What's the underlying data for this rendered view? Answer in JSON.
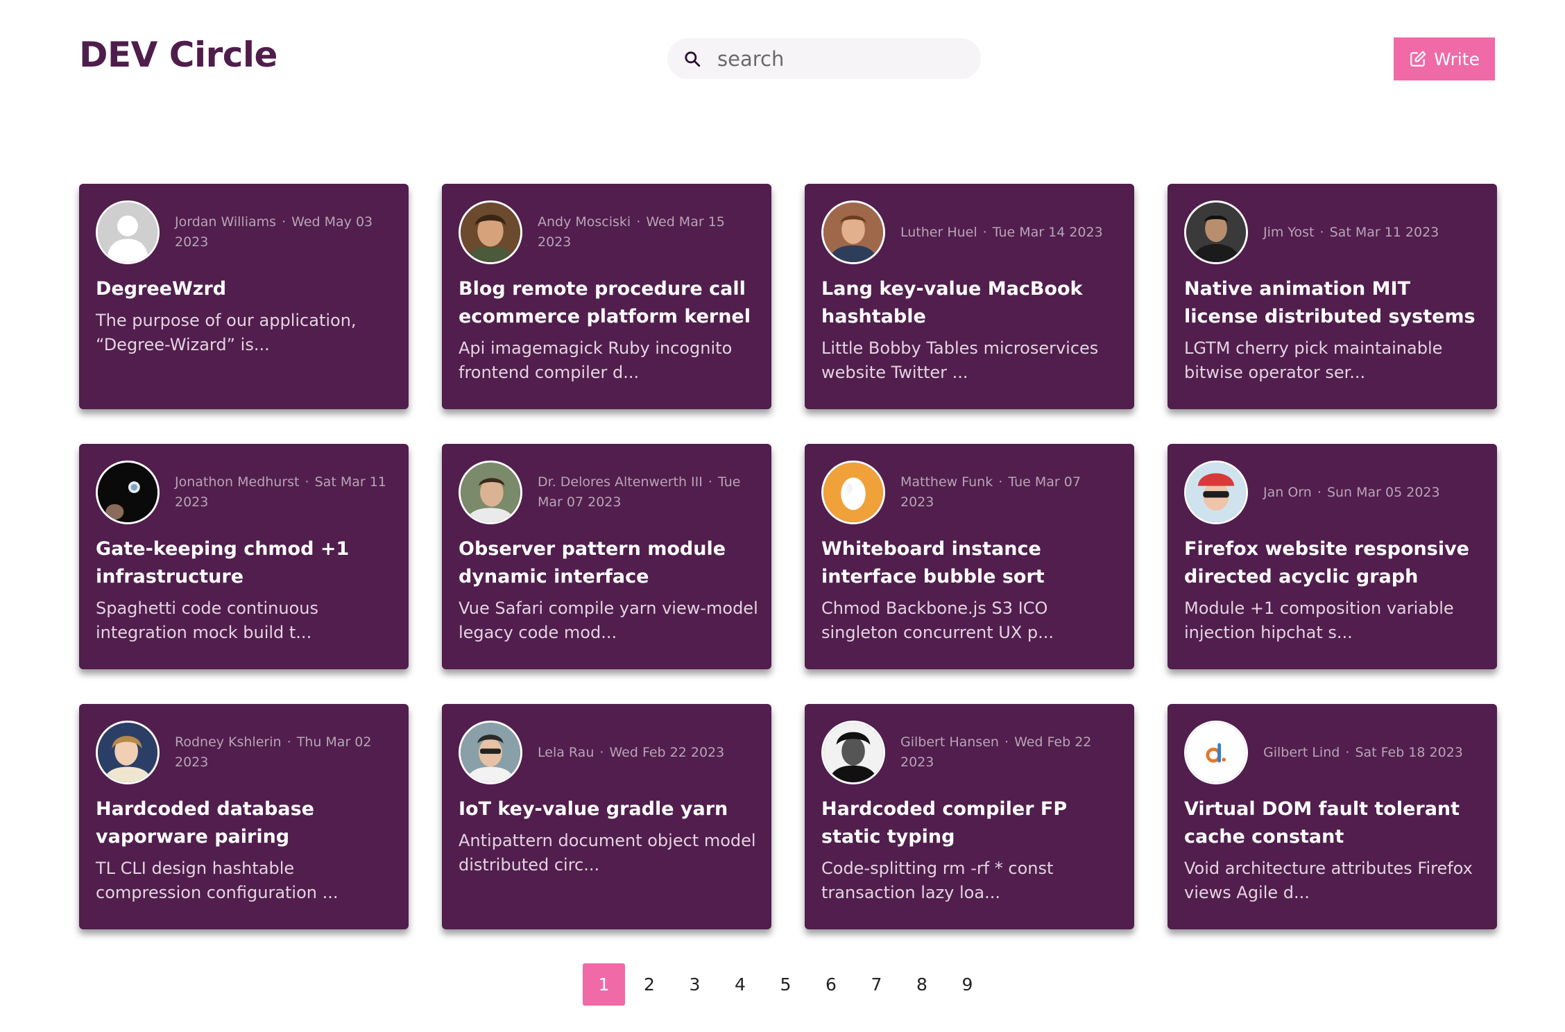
{
  "app": {
    "title": "DEV Circle"
  },
  "search": {
    "placeholder": "search"
  },
  "write": {
    "label": "Write"
  },
  "colors": {
    "brand": "#4f1d4c",
    "card_bg": "#511e4d",
    "accent": "#ef6aa7"
  },
  "posts": [
    {
      "author": "Jordan Williams",
      "date": "Wed May 03 2023",
      "title": "DegreeWzrd",
      "excerpt": "The purpose of our application, “Degree-Wizard” is...",
      "avatar": "default-avatar-icon"
    },
    {
      "author": "Andy Mosciski",
      "date": "Wed Mar 15 2023",
      "title": "Blog remote procedure call ecommerce platform kernel",
      "excerpt": "Api imagemagick Ruby incognito frontend compiler d...",
      "avatar": "user-photo"
    },
    {
      "author": "Luther Huel",
      "date": "Tue Mar 14 2023",
      "title": "Lang key-value MacBook hashtable",
      "excerpt": "Little Bobby Tables microservices website Twitter ...",
      "avatar": "user-photo"
    },
    {
      "author": "Jim Yost",
      "date": "Sat Mar 11 2023",
      "title": "Native animation MIT license distributed systems",
      "excerpt": "LGTM cherry pick maintainable bitwise operator ser...",
      "avatar": "user-photo"
    },
    {
      "author": "Jonathon Medhurst",
      "date": "Sat Mar 11 2023",
      "title": "Gate-keeping chmod +1 infrastructure",
      "excerpt": "Spaghetti code continuous integration mock build t...",
      "avatar": "user-photo"
    },
    {
      "author": "Dr. Delores Altenwerth III",
      "date": "Tue Mar 07 2023",
      "title": "Observer pattern module dynamic interface",
      "excerpt": "Vue Safari compile yarn view-model legacy code mod...",
      "avatar": "user-photo"
    },
    {
      "author": "Matthew Funk",
      "date": "Tue Mar 07 2023",
      "title": "Whiteboard instance interface bubble sort",
      "excerpt": "Chmod Backbone.js S3 ICO singleton concurrent UX p...",
      "avatar": "egg-avatar-icon"
    },
    {
      "author": "Jan Orn",
      "date": "Sun Mar 05 2023",
      "title": "Firefox website responsive directed acyclic graph",
      "excerpt": "Module +1 composition variable injection hipchat s...",
      "avatar": "user-photo"
    },
    {
      "author": "Rodney Kshlerin",
      "date": "Thu Mar 02 2023",
      "title": "Hardcoded database vaporware pairing",
      "excerpt": "TL CLI design hashtable compression configuration ...",
      "avatar": "user-photo"
    },
    {
      "author": "Lela Rau",
      "date": "Wed Feb 22 2023",
      "title": "IoT key-value gradle yarn",
      "excerpt": "Antipattern document object model distributed circ...",
      "avatar": "user-photo"
    },
    {
      "author": "Gilbert Hansen",
      "date": "Wed Feb 22 2023",
      "title": "Hardcoded compiler FP static typing",
      "excerpt": "Code-splitting rm -rf * const transaction lazy loa...",
      "avatar": "user-photo"
    },
    {
      "author": "Gilbert Lind",
      "date": "Sat Feb 18 2023",
      "title": "Virtual DOM fault tolerant cache constant",
      "excerpt": "Void architecture attributes Firefox views Agile d...",
      "avatar": "d-logo-icon"
    }
  ],
  "pagination": {
    "current": "1",
    "pages": [
      "1",
      "2",
      "3",
      "4",
      "5",
      "6",
      "7",
      "8",
      "9"
    ]
  }
}
